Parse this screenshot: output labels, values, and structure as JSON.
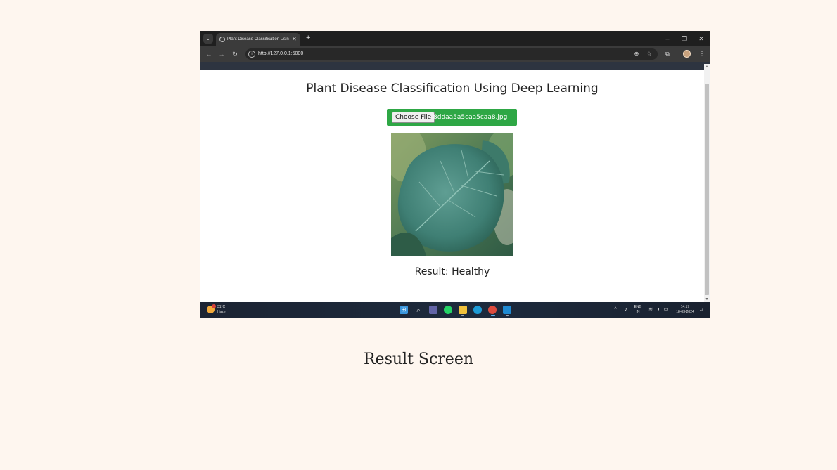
{
  "browser": {
    "tab_title": "Plant Disease Classification Using",
    "tab_close": "✕",
    "new_tab": "+",
    "url": "http://127.0.0.1:5000",
    "window_controls": {
      "minimize": "–",
      "restore": "❐",
      "close": "✕"
    }
  },
  "page": {
    "title": "Plant Disease Classification Using Deep Learning",
    "choose_file_label": "Choose File",
    "file_name": "8ddaa5a5caa5caa8.jpg",
    "result": "Result: Healthy",
    "upload_color": "#2ea745"
  },
  "taskbar": {
    "weather_temp": "31°C",
    "weather_condition": "Haze",
    "language_top": "ENG",
    "language_bottom": "IN",
    "time": "14:17",
    "date": "18-03-2024",
    "apps": [
      "start-icon",
      "search-icon",
      "teams-icon",
      "whatsapp-icon",
      "file-explorer-icon",
      "edge-icon",
      "chrome-icon",
      "vscode-icon"
    ]
  },
  "caption": "Result Screen"
}
